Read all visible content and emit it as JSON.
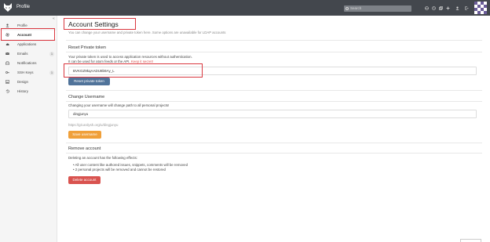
{
  "topbar": {
    "title": "Profile",
    "search_placeholder": "Search",
    "icons": [
      "globe-icon",
      "clock-icon",
      "copy-icon",
      "plus-icon",
      "user-icon"
    ]
  },
  "sidebar": {
    "collapse_glyph": "«",
    "items": [
      {
        "label": "Profile",
        "icon": "user-icon",
        "active": false,
        "badge": ""
      },
      {
        "label": "Account",
        "icon": "gear-icon",
        "active": true,
        "badge": ""
      },
      {
        "label": "Applications",
        "icon": "cloud-icon",
        "active": false,
        "badge": ""
      },
      {
        "label": "Emails",
        "icon": "envelope-icon",
        "active": false,
        "badge": "1"
      },
      {
        "label": "Notifications",
        "icon": "inbox-icon",
        "active": false,
        "badge": ""
      },
      {
        "label": "SSH Keys",
        "icon": "key-icon",
        "active": false,
        "badge": "1"
      },
      {
        "label": "Design",
        "icon": "image-icon",
        "active": false,
        "badge": ""
      },
      {
        "label": "History",
        "icon": "history-icon",
        "active": false,
        "badge": ""
      }
    ]
  },
  "main": {
    "title": "Account Settings",
    "subtitle": "You can change your username and private token here. Some options are unavailable for LDAP accounts",
    "token": {
      "heading": "Reset Private token",
      "line1": "Your private token is used to access application resources without authentication.",
      "line2_prefix": "It can be used for atom feeds or the API.",
      "line2_warning": "Keep it secret!",
      "value": "BVKGZ9kqAADU8b9Ay_L",
      "button": "Reset private token"
    },
    "username": {
      "heading": "Change Username",
      "description": "Changing your username will change path to all personal projects!",
      "value": "dingjunyu",
      "path_hint": "https://git.ardysh.org/u/dingjunyu",
      "button": "Save username"
    },
    "remove": {
      "heading": "Remove account",
      "description": "Deleting an account has the following effects:",
      "bullets": [
        "All user content like authored issues, snippets, comments will be removed",
        "2 personal projects will be removed and cannot be restored"
      ],
      "button": "Delete account"
    }
  },
  "colors": {
    "topbar": "#43474d",
    "highlight": "#d9363e",
    "button_blue": "#50739a",
    "button_orange": "#f0a03a",
    "button_red": "#d9534f"
  }
}
